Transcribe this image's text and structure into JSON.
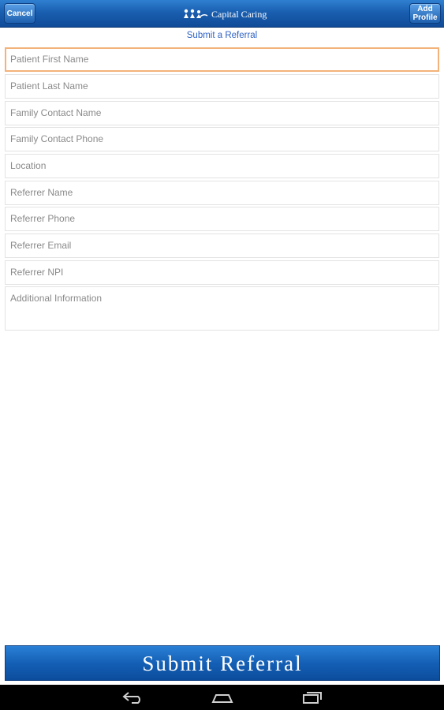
{
  "header": {
    "cancel_label": "Cancel",
    "add_profile_label": "Add\nProfile",
    "brand_name": "Capital Caring"
  },
  "page_title": "Submit a Referral",
  "form": {
    "patient_first_name": "Patient First Name",
    "patient_last_name": "Patient Last Name",
    "family_contact_name": "Family Contact Name",
    "family_contact_phone": "Family Contact Phone",
    "location": "Location",
    "referrer_name": "Referrer Name",
    "referrer_phone": "Referrer Phone",
    "referrer_email": "Referrer Email",
    "referrer_npi": "Referrer NPI",
    "additional_information": "Additional Information"
  },
  "submit_label": "Submit Referral",
  "navbar": {
    "back": "back-icon",
    "home": "home-icon",
    "recents": "recents-icon"
  },
  "colors": {
    "header_blue": "#1a5fb0",
    "link_blue": "#2f63c4",
    "focus_orange": "#f3b27a"
  }
}
